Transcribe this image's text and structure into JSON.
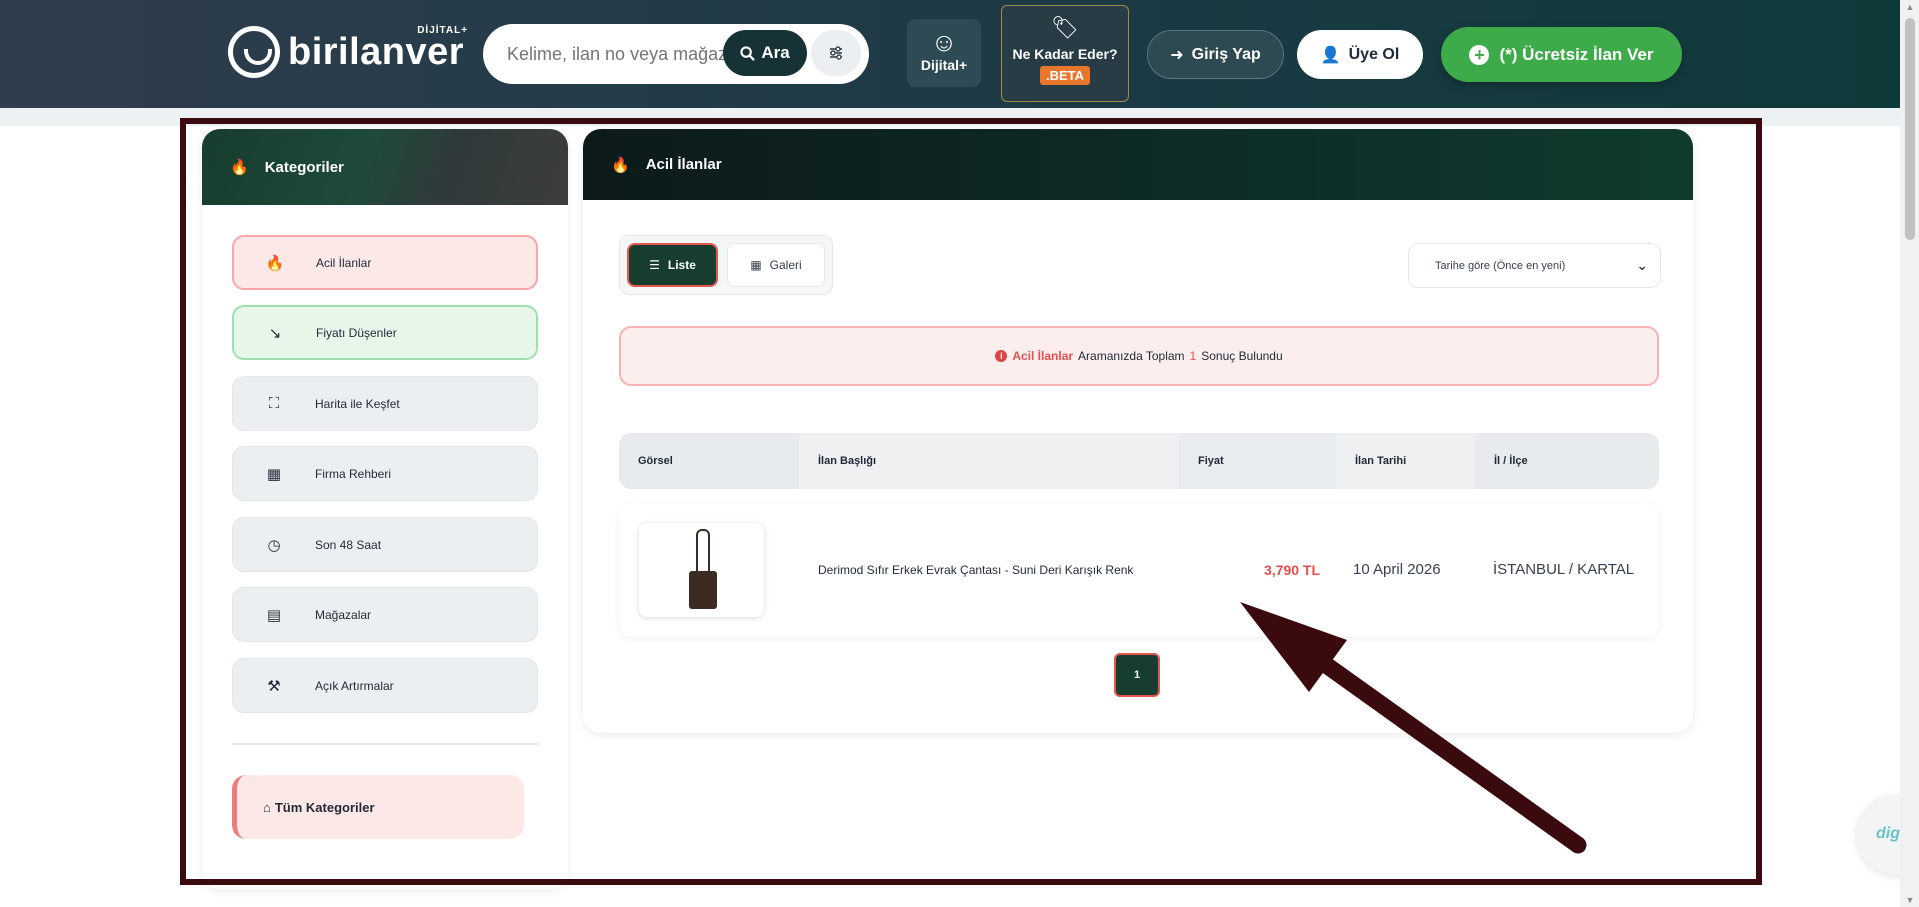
{
  "header": {
    "logo_text": "birilanver",
    "logo_badge": "DİJİTAL+",
    "search_placeholder": "Kelime, ilan no veya mağaza",
    "search_button": "Ara",
    "dijital_label": "Dijital+",
    "nekadar_label": "Ne Kadar Eder?",
    "nekadar_badge": ".BETA",
    "login_label": "Giriş Yap",
    "signup_label": "Üye Ol",
    "post_label": "(*) Ücretsiz İlan Ver"
  },
  "sidebar": {
    "title": "Kategoriler",
    "items": [
      {
        "label": "Acil İlanlar",
        "icon": "fire-icon"
      },
      {
        "label": "Fiyatı Düşenler",
        "icon": "trend-down-icon"
      },
      {
        "label": "Harita ile Keşfet",
        "icon": "map-icon"
      },
      {
        "label": "Firma Rehberi",
        "icon": "building-icon"
      },
      {
        "label": "Son 48 Saat",
        "icon": "clock-icon"
      },
      {
        "label": "Mağazalar",
        "icon": "store-icon"
      },
      {
        "label": "Açık Artırmalar",
        "icon": "gavel-icon"
      }
    ],
    "all_categories": "Tüm Kategoriler"
  },
  "main": {
    "title": "Acil İlanlar",
    "view_list": "Liste",
    "view_gallery": "Galeri",
    "sort_selected": "Tarihe göre (Önce en yeni)",
    "result": {
      "highlight": "Acil İlanlar",
      "middle": "Aramanızda Toplam",
      "count": "1",
      "suffix": "Sonuç Bulundu"
    },
    "columns": [
      "Görsel",
      "İlan Başlığı",
      "Fiyat",
      "İlan Tarihi",
      "İl / İlçe"
    ],
    "rows": [
      {
        "title": "Derimod Sıfır Erkek Evrak Çantası - Suni Deri Karışık Renk",
        "price": "3,790 TL",
        "date": "10 April 2026",
        "location": "İSTANBUL / KARTAL"
      }
    ],
    "pages": [
      "1"
    ]
  },
  "chat_widget": "digi",
  "colors": {
    "accent_red": "#e45050",
    "brand_green": "#3dab4a",
    "dark_green": "#163d2e",
    "annotation": "#3b0a0f"
  }
}
